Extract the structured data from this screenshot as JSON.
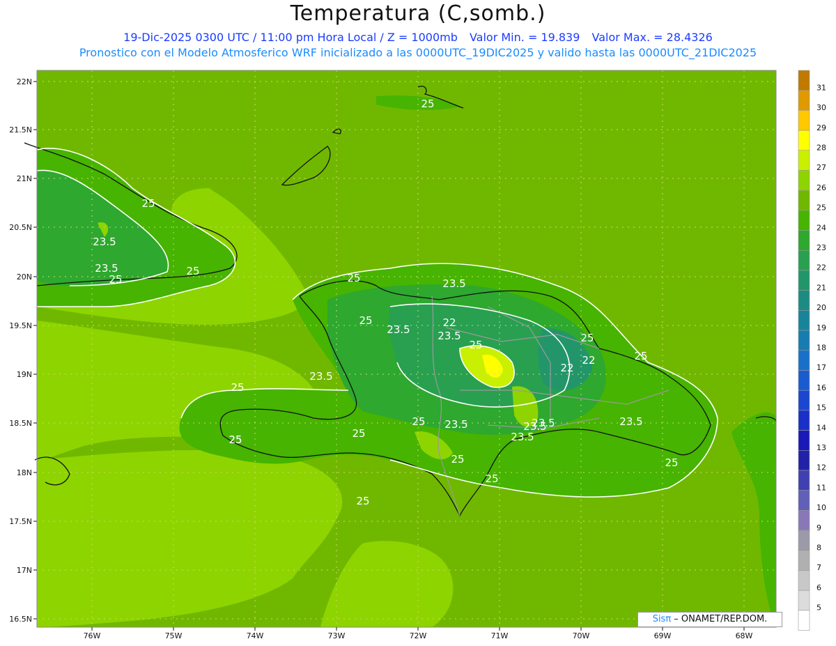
{
  "header": {
    "title": "Temperatura (C,somb.)",
    "time_label": "19-Dic-2025 0300 UTC / 11:00 pm Hora Local / Z = 1000mb",
    "min_label": "Valor Min. = 19.839",
    "max_label": "Valor Max. = 28.4326",
    "model_label": "Pronostico con el Modelo Atmosferico WRF inicializado a las 0000UTC_19DIC2025 y valido hasta las  0000UTC_21DIC2025"
  },
  "map": {
    "lat_labels": [
      "22N",
      "21.5N",
      "21N",
      "20.5N",
      "20N",
      "19.5N",
      "19N",
      "18.5N",
      "18N",
      "17.5N",
      "17N",
      "16.5N"
    ],
    "lon_labels": [
      "76W",
      "75W",
      "74W",
      "73W",
      "72W",
      "71W",
      "70W",
      "69W",
      "68W"
    ],
    "contour_labels": [
      {
        "text": "25"
      },
      {
        "text": "25"
      },
      {
        "text": "23.5"
      },
      {
        "text": "23.5"
      },
      {
        "text": "25"
      },
      {
        "text": "25"
      },
      {
        "text": "25"
      },
      {
        "text": "25"
      },
      {
        "text": "23.5"
      },
      {
        "text": "25"
      },
      {
        "text": "23.5"
      },
      {
        "text": "22"
      },
      {
        "text": "23.5"
      },
      {
        "text": "25"
      },
      {
        "text": "23.5"
      },
      {
        "text": "22"
      },
      {
        "text": "22"
      },
      {
        "text": "25"
      },
      {
        "text": "25"
      },
      {
        "text": "25"
      },
      {
        "text": "25"
      },
      {
        "text": "25"
      },
      {
        "text": "23.5"
      },
      {
        "text": "23.5"
      },
      {
        "text": "25"
      },
      {
        "text": "23.5"
      },
      {
        "text": "23.5"
      },
      {
        "text": "23.5"
      },
      {
        "text": "25"
      },
      {
        "text": "25"
      },
      {
        "text": "25"
      },
      {
        "text": "25"
      }
    ]
  },
  "colorbar": {
    "levels": [
      {
        "value": "31",
        "color": "#c07a00"
      },
      {
        "value": "30",
        "color": "#e09a00"
      },
      {
        "value": "29",
        "color": "#ffc800"
      },
      {
        "value": "28",
        "color": "#ffff00"
      },
      {
        "value": "27",
        "color": "#c8f000"
      },
      {
        "value": "26",
        "color": "#8ed400"
      },
      {
        "value": "25",
        "color": "#70b800"
      },
      {
        "value": "24",
        "color": "#46b400"
      },
      {
        "value": "23",
        "color": "#2ea82e"
      },
      {
        "value": "22",
        "color": "#28a050"
      },
      {
        "value": "21",
        "color": "#22966a"
      },
      {
        "value": "20",
        "color": "#1c8c82"
      },
      {
        "value": "19",
        "color": "#18849a"
      },
      {
        "value": "18",
        "color": "#187cb0"
      },
      {
        "value": "17",
        "color": "#1a70c8"
      },
      {
        "value": "16",
        "color": "#1a5cd0"
      },
      {
        "value": "15",
        "color": "#1a46d0"
      },
      {
        "value": "14",
        "color": "#1a30c8"
      },
      {
        "value": "13",
        "color": "#1a1ab8"
      },
      {
        "value": "12",
        "color": "#2222a8"
      },
      {
        "value": "11",
        "color": "#4040b0"
      },
      {
        "value": "10",
        "color": "#6060b8"
      },
      {
        "value": "9",
        "color": "#8878b8"
      },
      {
        "value": "8",
        "color": "#9a9aa8"
      },
      {
        "value": "7",
        "color": "#b0b0b0"
      },
      {
        "value": "6",
        "color": "#c8c8c8"
      },
      {
        "value": "5",
        "color": "#dcdcdc"
      },
      {
        "value": "",
        "color": "#ffffff"
      }
    ]
  },
  "credit": {
    "sis": "Sisπ",
    "org": " – ONAMET/REP.DOM."
  }
}
